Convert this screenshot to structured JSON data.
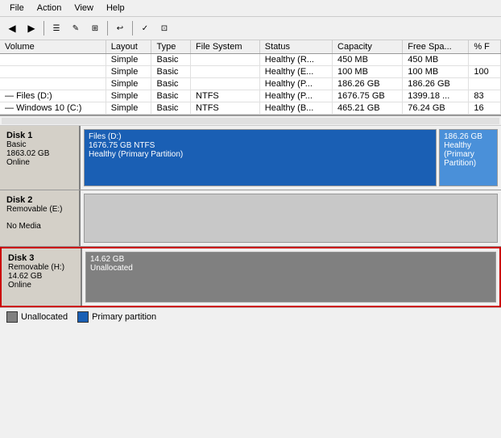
{
  "menu": {
    "items": [
      "File",
      "Action",
      "View",
      "Help"
    ]
  },
  "toolbar": {
    "buttons": [
      "←",
      "→",
      "☰",
      "✎",
      "⊞",
      "⊟",
      "↩",
      "✓",
      "⊡"
    ]
  },
  "table": {
    "headers": [
      "Volume",
      "Layout",
      "Type",
      "File System",
      "Status",
      "Capacity",
      "Free Spa...",
      "% F"
    ],
    "rows": [
      {
        "volume": "",
        "layout": "Simple",
        "type": "Basic",
        "filesystem": "",
        "status": "Healthy (R...",
        "capacity": "450 MB",
        "free": "450 MB",
        "pct": ""
      },
      {
        "volume": "",
        "layout": "Simple",
        "type": "Basic",
        "filesystem": "",
        "status": "Healthy (E...",
        "capacity": "100 MB",
        "free": "100 MB",
        "pct": "100"
      },
      {
        "volume": "",
        "layout": "Simple",
        "type": "Basic",
        "filesystem": "",
        "status": "Healthy (P...",
        "capacity": "186.26 GB",
        "free": "186.26 GB",
        "pct": ""
      },
      {
        "volume": "Files (D:)",
        "layout": "Simple",
        "type": "Basic",
        "filesystem": "NTFS",
        "status": "Healthy (P...",
        "capacity": "1676.75 GB",
        "free": "1399.18 ...",
        "pct": "83"
      },
      {
        "volume": "Windows 10 (C:)",
        "layout": "Simple",
        "type": "Basic",
        "filesystem": "NTFS",
        "status": "Healthy (B...",
        "capacity": "465.21 GB",
        "free": "76.24 GB",
        "pct": "16"
      }
    ]
  },
  "disks": {
    "disk1": {
      "name": "Disk 1",
      "type": "Basic",
      "size": "1863.02 GB",
      "status": "Online",
      "partitions": [
        {
          "label": "Files (D:)",
          "size": "1676.75 GB NTFS",
          "status": "Healthy (Primary Partition)",
          "type": "primary",
          "flex": 7
        },
        {
          "label": "",
          "size": "186.26 GB",
          "status": "Healthy (Primary Partition)",
          "type": "primary-2",
          "flex": 1
        }
      ]
    },
    "disk2": {
      "name": "Disk 2",
      "type": "Removable (E:)",
      "size": "",
      "status": "No Media",
      "partitions": []
    },
    "disk3": {
      "name": "Disk 3",
      "type": "Removable (H:)",
      "size": "14.62 GB",
      "status": "Online",
      "partitions": [
        {
          "label": "",
          "size": "14.62 GB",
          "status": "Unallocated",
          "type": "unallocated",
          "flex": 1
        }
      ]
    }
  },
  "legend": {
    "items": [
      {
        "label": "Unallocated",
        "type": "unalloc"
      },
      {
        "label": "Primary partition",
        "type": "primary"
      }
    ]
  }
}
